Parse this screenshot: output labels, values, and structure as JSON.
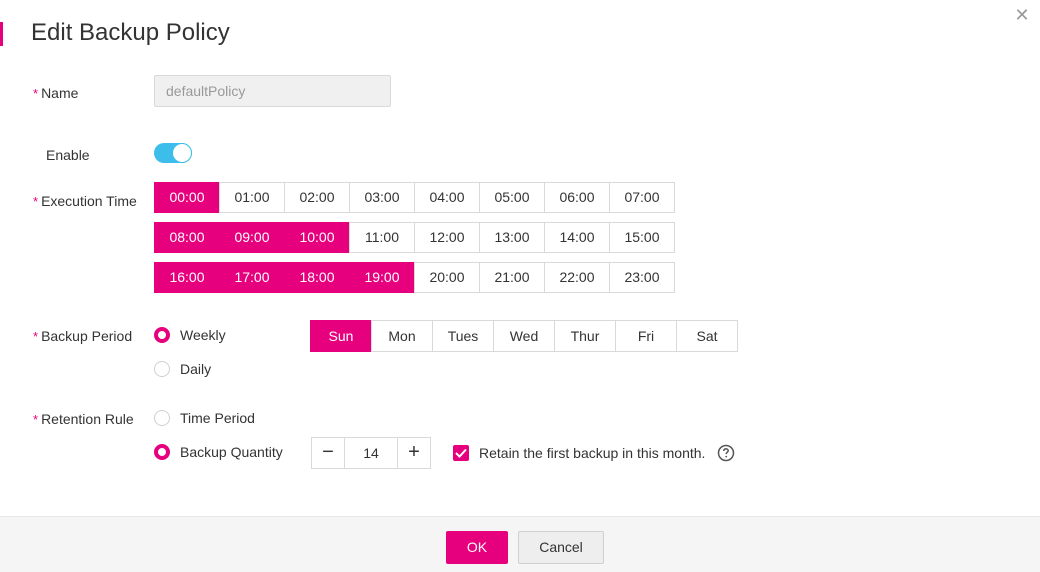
{
  "dialog": {
    "title": "Edit Backup Policy",
    "close_icon": "close-icon",
    "accent_color": "#e6007e"
  },
  "form": {
    "name": {
      "required_mark": "*",
      "label": "Name",
      "value": "defaultPolicy"
    },
    "enable": {
      "label": "Enable",
      "on": true,
      "toggle_color": "#3dbdea"
    },
    "execution_time": {
      "required_mark": "*",
      "label": "Execution Time",
      "rows": [
        [
          {
            "t": "00:00",
            "sel": true
          },
          {
            "t": "01:00",
            "sel": false
          },
          {
            "t": "02:00",
            "sel": false
          },
          {
            "t": "03:00",
            "sel": false
          },
          {
            "t": "04:00",
            "sel": false
          },
          {
            "t": "05:00",
            "sel": false
          },
          {
            "t": "06:00",
            "sel": false
          },
          {
            "t": "07:00",
            "sel": false
          }
        ],
        [
          {
            "t": "08:00",
            "sel": true
          },
          {
            "t": "09:00",
            "sel": true
          },
          {
            "t": "10:00",
            "sel": true
          },
          {
            "t": "11:00",
            "sel": false
          },
          {
            "t": "12:00",
            "sel": false
          },
          {
            "t": "13:00",
            "sel": false
          },
          {
            "t": "14:00",
            "sel": false
          },
          {
            "t": "15:00",
            "sel": false
          }
        ],
        [
          {
            "t": "16:00",
            "sel": true
          },
          {
            "t": "17:00",
            "sel": true
          },
          {
            "t": "18:00",
            "sel": true
          },
          {
            "t": "19:00",
            "sel": true
          },
          {
            "t": "20:00",
            "sel": false
          },
          {
            "t": "21:00",
            "sel": false
          },
          {
            "t": "22:00",
            "sel": false
          },
          {
            "t": "23:00",
            "sel": false
          }
        ]
      ]
    },
    "backup_period": {
      "required_mark": "*",
      "label": "Backup Period",
      "options": [
        {
          "label": "Weekly",
          "checked": true
        },
        {
          "label": "Daily",
          "checked": false
        }
      ],
      "days": [
        {
          "d": "Sun",
          "sel": true
        },
        {
          "d": "Mon",
          "sel": false
        },
        {
          "d": "Tues",
          "sel": false
        },
        {
          "d": "Wed",
          "sel": false
        },
        {
          "d": "Thur",
          "sel": false
        },
        {
          "d": "Fri",
          "sel": false
        },
        {
          "d": "Sat",
          "sel": false
        }
      ]
    },
    "retention_rule": {
      "required_mark": "*",
      "label": "Retention Rule",
      "options": [
        {
          "label": "Time Period",
          "checked": false
        },
        {
          "label": "Backup Quantity",
          "checked": true
        }
      ],
      "quantity": {
        "minus": "−",
        "value": "14",
        "plus": "+"
      },
      "retain_first": {
        "label": "Retain the first backup in this month.",
        "checked": true,
        "help_icon": "help-circle-icon"
      }
    }
  },
  "footer": {
    "ok_label": "OK",
    "cancel_label": "Cancel"
  }
}
